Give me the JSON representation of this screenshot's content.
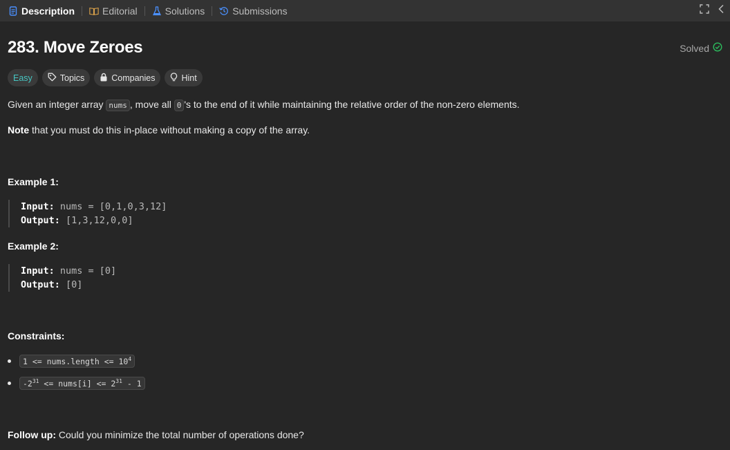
{
  "tabs": [
    {
      "label": "Description",
      "icon": "document-icon",
      "active": true
    },
    {
      "label": "Editorial",
      "icon": "book-icon",
      "active": false
    },
    {
      "label": "Solutions",
      "icon": "flask-icon",
      "active": false
    },
    {
      "label": "Submissions",
      "icon": "history-icon",
      "active": false
    }
  ],
  "problem": {
    "title": "283. Move Zeroes",
    "status": "Solved",
    "tags": {
      "difficulty": "Easy",
      "topics": "Topics",
      "companies": "Companies",
      "hint": "Hint"
    },
    "description": {
      "p1_before": "Given an integer array ",
      "p1_code1": "nums",
      "p1_mid": ", move all ",
      "p1_code2": "0",
      "p1_after": "'s to the end of it while maintaining the relative order of the non-zero elements.",
      "note_bold": "Note",
      "note_rest": " that you must do this in-place without making a copy of the array."
    },
    "examples": [
      {
        "heading": "Example 1:",
        "input_label": "Input:",
        "input_value": " nums = [0,1,0,3,12]",
        "output_label": "Output:",
        "output_value": " [1,3,12,0,0]"
      },
      {
        "heading": "Example 2:",
        "input_label": "Input:",
        "input_value": " nums = [0]",
        "output_label": "Output:",
        "output_value": " [0]"
      }
    ],
    "constraints": {
      "heading": "Constraints:",
      "c1_pre": "1 <= nums.length <= 10",
      "c1_sup": "4",
      "c2_a": "-2",
      "c2_sup1": "31",
      "c2_b": " <= nums[i] <= 2",
      "c2_sup2": "31",
      "c2_c": " - 1"
    },
    "follow_up": {
      "bold": "Follow up:",
      "text": " Could you minimize the total number of operations done?"
    }
  },
  "colors": {
    "accent_easy": "#46c6c2",
    "solved_check": "#2cbb5d",
    "tab_icon_blue": "#4a90ff",
    "tab_icon_orange": "#d9a14a",
    "background": "#262626"
  }
}
